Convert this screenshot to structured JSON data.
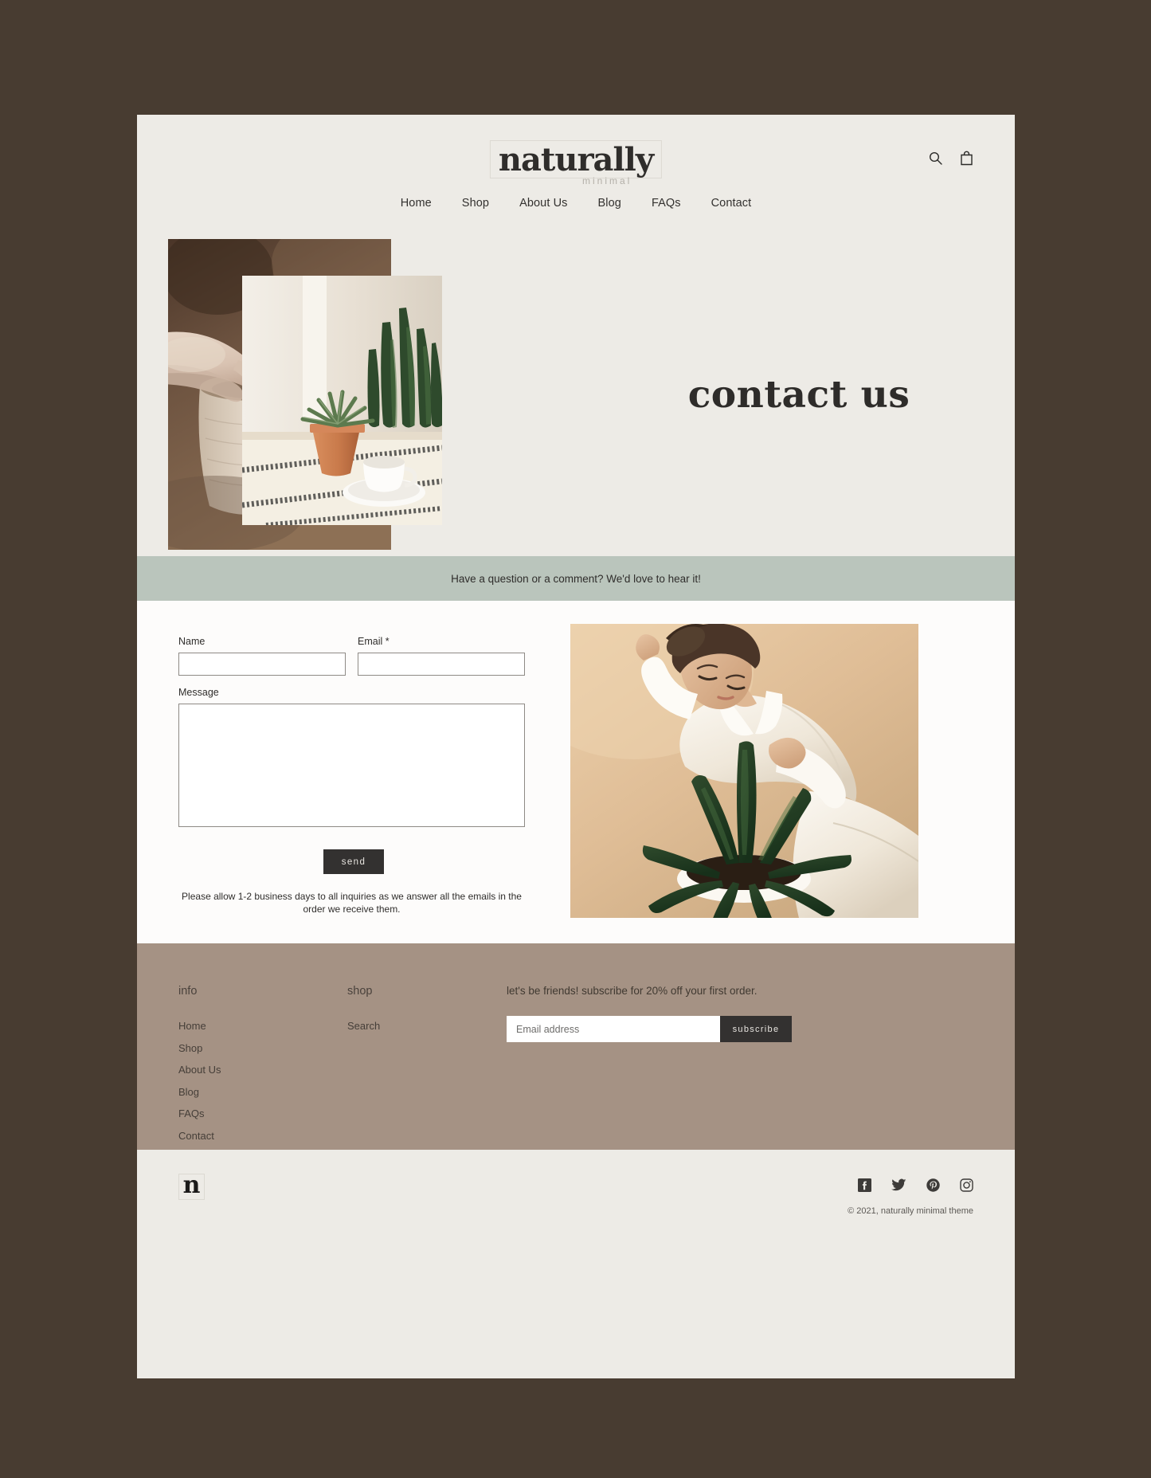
{
  "colors": {
    "outer_bg": "#483c31",
    "page_bg": "#edebe6",
    "banner_green": "#bac5bc",
    "footer_taupe": "#a59284",
    "button_dark": "#333130",
    "content_white": "#fdfcfb"
  },
  "header": {
    "logo_word": "naturally",
    "logo_sub": "minimal",
    "search_icon": "search-icon",
    "cart_icon": "shopping-bag-icon",
    "nav": [
      {
        "label": "Home"
      },
      {
        "label": "Shop"
      },
      {
        "label": "About Us"
      },
      {
        "label": "Blog"
      },
      {
        "label": "FAQs"
      },
      {
        "label": "Contact"
      }
    ]
  },
  "hero": {
    "title": "contact us",
    "image_back_alt": "hands shaping clay pot on pottery wheel",
    "image_front_alt": "potted succulent and white cup on striped table runner"
  },
  "banner": {
    "text": "Have a question or a comment? We'd love to hear it!"
  },
  "contact_form": {
    "name_label": "Name",
    "name_value": "",
    "email_label": "Email *",
    "email_value": "",
    "message_label": "Message",
    "message_value": "",
    "send_label": "send",
    "note": "Please allow 1-2 business days to all inquiries as we answer all the emails in the order we receive them."
  },
  "contact_photo": {
    "alt": "woman in white shirt holding a snake plant"
  },
  "footer": {
    "info": {
      "heading": "info",
      "links": [
        {
          "label": "Home"
        },
        {
          "label": "Shop"
        },
        {
          "label": "About Us"
        },
        {
          "label": "Blog"
        },
        {
          "label": "FAQs"
        },
        {
          "label": "Contact"
        }
      ]
    },
    "shop": {
      "heading": "shop",
      "links": [
        {
          "label": "Search"
        }
      ]
    },
    "newsletter": {
      "text": "let's be friends! subscribe for 20% off your first order.",
      "placeholder": "Email address",
      "value": "",
      "button_label": "subscribe"
    }
  },
  "bottom_bar": {
    "logo_mark": "n",
    "copyright": "© 2021, naturally minimal theme",
    "social": [
      {
        "name": "facebook-icon"
      },
      {
        "name": "twitter-icon"
      },
      {
        "name": "pinterest-icon"
      },
      {
        "name": "instagram-icon"
      }
    ]
  }
}
